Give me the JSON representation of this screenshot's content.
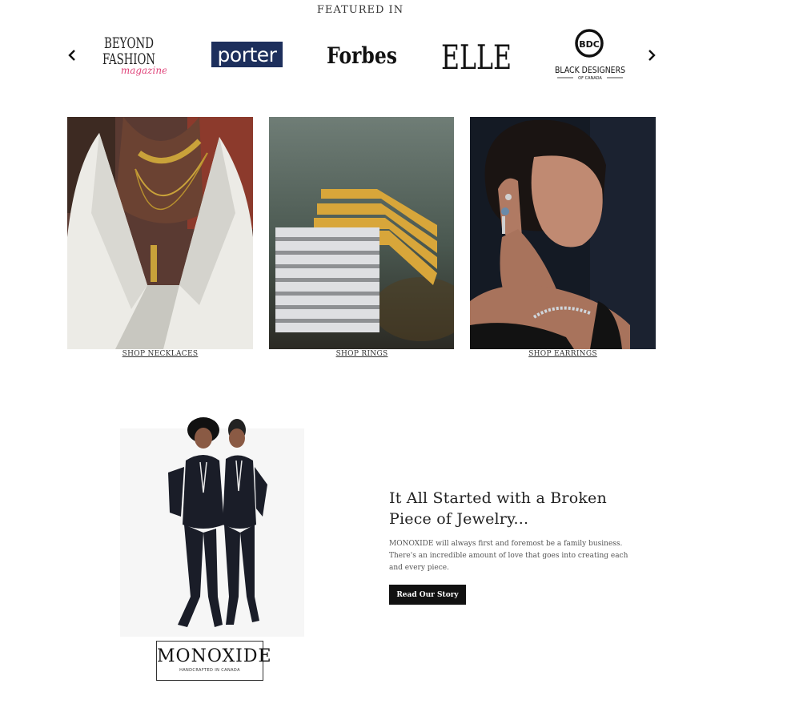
{
  "featured": {
    "title": "FEATURED IN",
    "logos": {
      "beyond_line1": "BEYOND",
      "beyond_line2": "FASHION",
      "beyond_line3": "magazine",
      "porter": "porter",
      "forbes": "Forbes",
      "elle": "ELLE",
      "bdc_mark": "BDC",
      "bdc_line1": "BLACK DESIGNERS",
      "bdc_line2": "OF CANADA"
    }
  },
  "collections": [
    {
      "label": "SHOP NECKLACES"
    },
    {
      "label": "SHOP RINGS"
    },
    {
      "label": "SHOP EARRINGS"
    }
  ],
  "story": {
    "brand": "MONOXIDE",
    "brand_tagline": "HANDCRAFTED IN CANADA",
    "title": "It All Started with a Broken Piece of Jewelry...",
    "body": "MONOXIDE will always first and foremost be a family business. There's an incredible amount of love that goes into creating each and every piece.",
    "button": "Read Our Story"
  },
  "colors": {
    "accent_pink": "#e0457b",
    "porter_navy": "#1d2f5c",
    "button_bg": "#111111"
  }
}
